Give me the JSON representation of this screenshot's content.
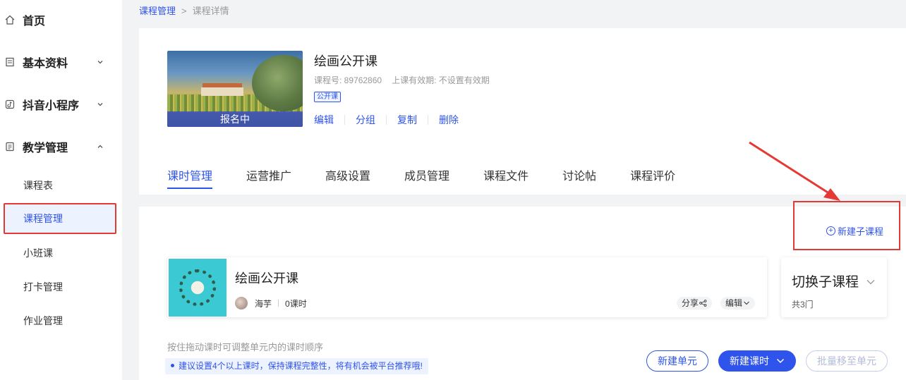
{
  "sidebar": {
    "items": [
      {
        "label": "首页",
        "icon": "home-icon"
      },
      {
        "label": "基本资料",
        "icon": "document-icon"
      },
      {
        "label": "抖音小程序",
        "icon": "tiktok-icon"
      },
      {
        "label": "教学管理",
        "icon": "clipboard-icon"
      }
    ],
    "sub_items": [
      "课程表",
      "课程管理",
      "小班课",
      "打卡管理",
      "作业管理"
    ]
  },
  "breadcrumb": {
    "parent": "课程管理",
    "separator": ">",
    "current": "课程详情"
  },
  "course": {
    "status": "报名中",
    "title": "绘画公开课",
    "number_label": "课程号: 89762860",
    "validity_label": "上课有效期: 不设置有效期",
    "tag": "公开课",
    "actions": [
      "编辑",
      "分组",
      "复制",
      "删除"
    ]
  },
  "tabs": [
    "课时管理",
    "运营推广",
    "高级设置",
    "成员管理",
    "课程文件",
    "讨论帖",
    "课程评价"
  ],
  "active_tab": "课时管理",
  "new_sub_course": "新建子课程",
  "sub_course": {
    "title": "绘画公开课",
    "teacher": "海芋",
    "lessons": "0课时",
    "share": "分享",
    "edit": "编辑"
  },
  "switch": {
    "title": "切换子课程",
    "count": "共3门"
  },
  "hint": "按住拖动课时可调整单元内的课时顺序",
  "notice": "建议设置4个以上课时，保持课程完整性，将有机会被平台推荐哦!",
  "buttons": {
    "new_unit": "新建单元",
    "new_lesson": "新建课时",
    "batch_move": "批量移至单元"
  },
  "colors": {
    "accent": "#2f54eb",
    "highlight": "#e53935",
    "status_overlay": "#3c50be"
  }
}
